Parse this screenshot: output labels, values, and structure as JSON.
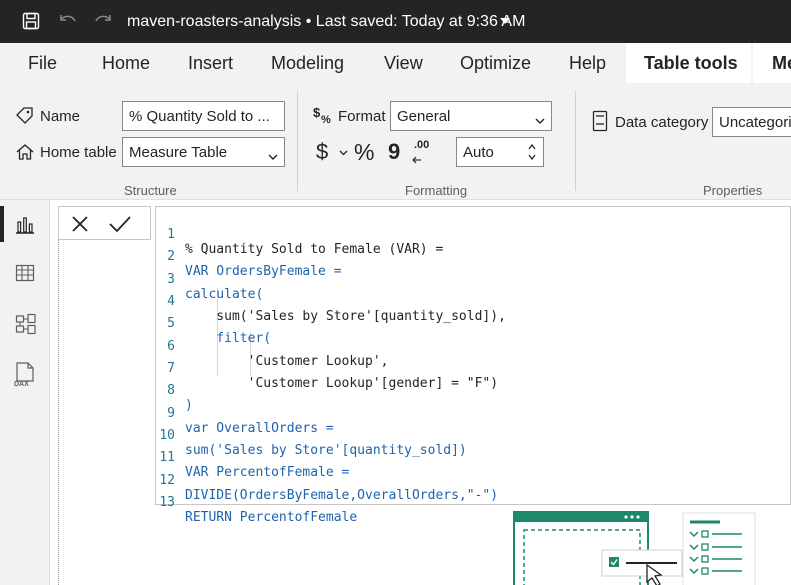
{
  "titlebar": {
    "filename": "maven-roasters-analysis",
    "separator": "•",
    "saved_status": "Last saved: Today at 9:36 AM"
  },
  "tabs": [
    {
      "label": "File"
    },
    {
      "label": "Home"
    },
    {
      "label": "Insert"
    },
    {
      "label": "Modeling"
    },
    {
      "label": "View"
    },
    {
      "label": "Optimize"
    },
    {
      "label": "Help"
    },
    {
      "label": "Table tools",
      "active": true
    },
    {
      "label": "Me"
    }
  ],
  "structure": {
    "name_label": "Name",
    "name_value": "% Quantity Sold to ...",
    "home_table_label": "Home table",
    "home_table_value": "Measure Table",
    "group_label": "Structure"
  },
  "formatting": {
    "format_label": "Format",
    "format_value": "General",
    "currency_symbol": "$",
    "percent_symbol": "%",
    "comma_symbol": "9",
    "decimal_symbol": ".00",
    "decimal_value": "Auto",
    "group_label": "Formatting"
  },
  "properties": {
    "data_category_label": "Data category",
    "data_category_value": "Uncategori",
    "group_label": "Properties"
  },
  "formula_bar": {
    "cancel_symbol": "✕",
    "commit_symbol": "✓"
  },
  "code_lines": [
    {
      "num": "1",
      "text": "% Quantity Sold to Female (VAR) ="
    },
    {
      "num": "2",
      "text": "VAR OrdersByFemale ="
    },
    {
      "num": "3",
      "text": "calculate("
    },
    {
      "num": "4",
      "text": "    sum('Sales by Store'[quantity_sold]),"
    },
    {
      "num": "5",
      "text": "    filter("
    },
    {
      "num": "6",
      "text": "        'Customer Lookup',"
    },
    {
      "num": "7",
      "text": "        'Customer Lookup'[gender] = \"F\")"
    },
    {
      "num": "8",
      "text": ")"
    },
    {
      "num": "9",
      "text": "var OverallOrders ="
    },
    {
      "num": "10",
      "text": "sum('Sales by Store'[quantity_sold])"
    },
    {
      "num": "11",
      "text": "VAR PercentofFemale ="
    },
    {
      "num": "12",
      "text": "DIVIDE(OrdersByFemale,OverallOrders,\"-\")"
    },
    {
      "num": "13",
      "text": "RETURN PercentofFemale"
    }
  ],
  "rail_icons": [
    "report-view-icon",
    "table-view-icon",
    "model-view-icon",
    "dax-query-view-icon"
  ],
  "colors": {
    "titlebar_bg": "#252423",
    "ribbon_bg": "#f3f2f1",
    "keyword": "#1f63ad",
    "string": "#a31515",
    "line_number": "#237893",
    "illustration_green": "#1b8a6b"
  }
}
